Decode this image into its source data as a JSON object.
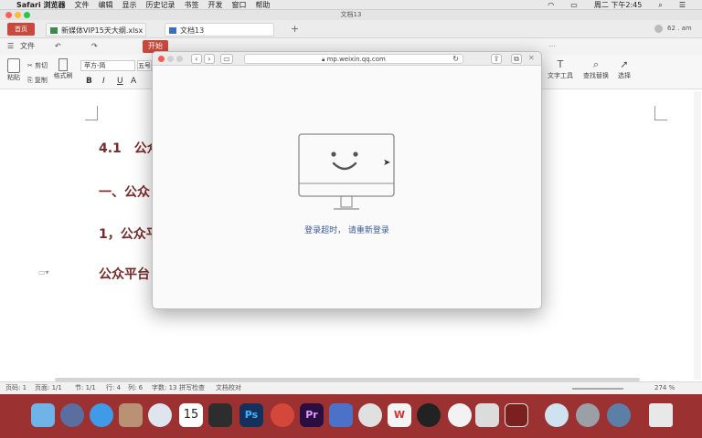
{
  "menubar": {
    "apple": "",
    "app": "Safari 浏览器",
    "items": [
      "文件",
      "编辑",
      "显示",
      "历史记录",
      "书签",
      "开发",
      "窗口",
      "帮助"
    ],
    "window_title": "文档13",
    "clock": "周二 下午2:45"
  },
  "tabs": {
    "home": "首页",
    "tab1": "新媒体VIP15天大纲.xlsx",
    "tab2": "文档13",
    "add": "+"
  },
  "toolbar1": {
    "file": "文件",
    "start": "开始"
  },
  "toolbar2": {
    "paste": "粘贴",
    "cut": "剪切",
    "copy": "复制",
    "format_painter": "格式刷",
    "font": "苹方-简",
    "font_size": "五号",
    "bold": "B",
    "italic": "I",
    "underline": "U",
    "text_tools": "文字工具",
    "find_replace": "查找替换",
    "select": "选择"
  },
  "document": {
    "h1": "4.1　公众",
    "h2": "一、公众",
    "h3": "1，公众平",
    "h4": "公众平台"
  },
  "popup": {
    "url": "mp.weixin.qq.com",
    "message": "登录超时， 请重新登录"
  },
  "status": {
    "page": "页码: 1",
    "pages": "页面: 1/1",
    "section": "节: 1/1",
    "row": "行: 4",
    "col": "列: 6",
    "words": "字数: 13",
    "spell": "拼写检查",
    "backup": "文档校对",
    "zoom": "274 %"
  }
}
